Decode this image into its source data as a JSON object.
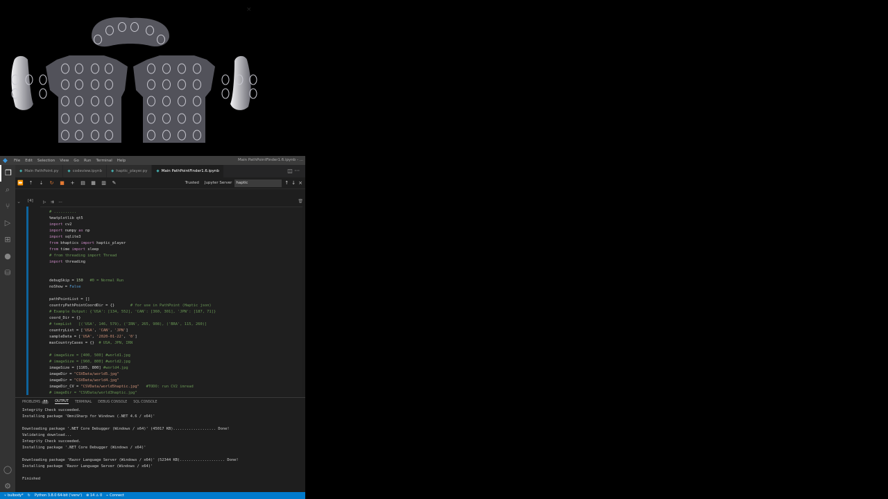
{
  "window": {
    "title": "Main PathPointFinder1.6.ipynb - ..."
  },
  "menu": [
    "File",
    "Edit",
    "Selection",
    "View",
    "Go",
    "Run",
    "Terminal",
    "Help"
  ],
  "tabs": [
    {
      "label": "Main PathPoint.py",
      "active": false
    },
    {
      "label": "codeview.ipynb",
      "active": false
    },
    {
      "label": "haptic_player.py",
      "active": false
    },
    {
      "label": "Main PathPointFinder1.6.ipynb",
      "active": true
    }
  ],
  "toolbar": {
    "trusted": "Trusted",
    "jupyter_server": "Jupyter Server",
    "find_value": "haptic"
  },
  "cell": {
    "count": "[4]"
  },
  "code_lines": [
    "# ..........",
    "%matplotlib qt5",
    "import cv2",
    "import numpy as np",
    "import sqlite3",
    "from bhaptics import haptic_player",
    "from time import sleep",
    "# from threading import Thread",
    "import threading",
    "",
    "",
    "debugSkip = 150   #0 = Normal Run",
    "noShow = False",
    "",
    "pathPointList = []",
    "countryPathPointCoordDir = {}       # for use in PathPoint (Haptic json)",
    "# Example Output: {'USA': [134, 552], 'CAN': [360, 301], 'JPN': [187, 71]}",
    "coord_Dir = {}",
    "# tempList   [('USA', 146, 579), ('IRN', 265, 908), ('BRA', 115, 260)]",
    "countryList = ['USA', 'CAN', 'JPN']",
    "sampleData = ['USA', '2020-01-22', '0']",
    "maxCountryCases = {}  # USA, JPN, IRN",
    "",
    "# imageSize = [400, 500] #world1.jpg",
    "# imageSize = [960, 800] #world2.jpg",
    "imageSize = [1165, 800] #world4.jpg",
    "imageDir = \"CSVData/world5.jpg\"",
    "imageDir = \"CSVData/world4.jpg\"",
    "imageDir_CV = \"CSVData/world5haptic.jpg\"   #TODO: run CV2 imread",
    "# imageDir = \"CSVData/world3haptic.jpg\""
  ],
  "panel": {
    "tabs": [
      {
        "label": "PROBLEMS",
        "badge": "77",
        "active": false
      },
      {
        "label": "OUTPUT",
        "active": true
      },
      {
        "label": "TERMINAL",
        "active": false
      },
      {
        "label": "DEBUG CONSOLE",
        "active": false
      },
      {
        "label": "SQL CONSOLE",
        "active": false
      }
    ],
    "output": [
      "Integrity Check succeeded.",
      "Installing package 'OmniSharp for Windows (.NET 4.6 / x64)'",
      "",
      "Downloading package '.NET Core Debugger (Windows / x64)' (45017 KB)................... Done!",
      "Validating download...",
      "Integrity Check succeeded.",
      "Installing package '.NET Core Debugger (Windows / x64)'",
      "",
      "Downloading package 'Razor Language Server (Windows / x64)' (52344 KB).................... Done!",
      "Installing package 'Razor Language Server (Windows / x64)'",
      "",
      "Finished"
    ]
  },
  "statusbar": {
    "branch": "bulbody*",
    "python": "Python 3.8.0 64-bit ('venv')",
    "problems": "⊗ 14 ⚠ 0",
    "connect": "Connect"
  },
  "colors": {
    "accent": "#007acc",
    "body_gray": "#52525a",
    "tactor_ring": "#c8c8d0"
  }
}
